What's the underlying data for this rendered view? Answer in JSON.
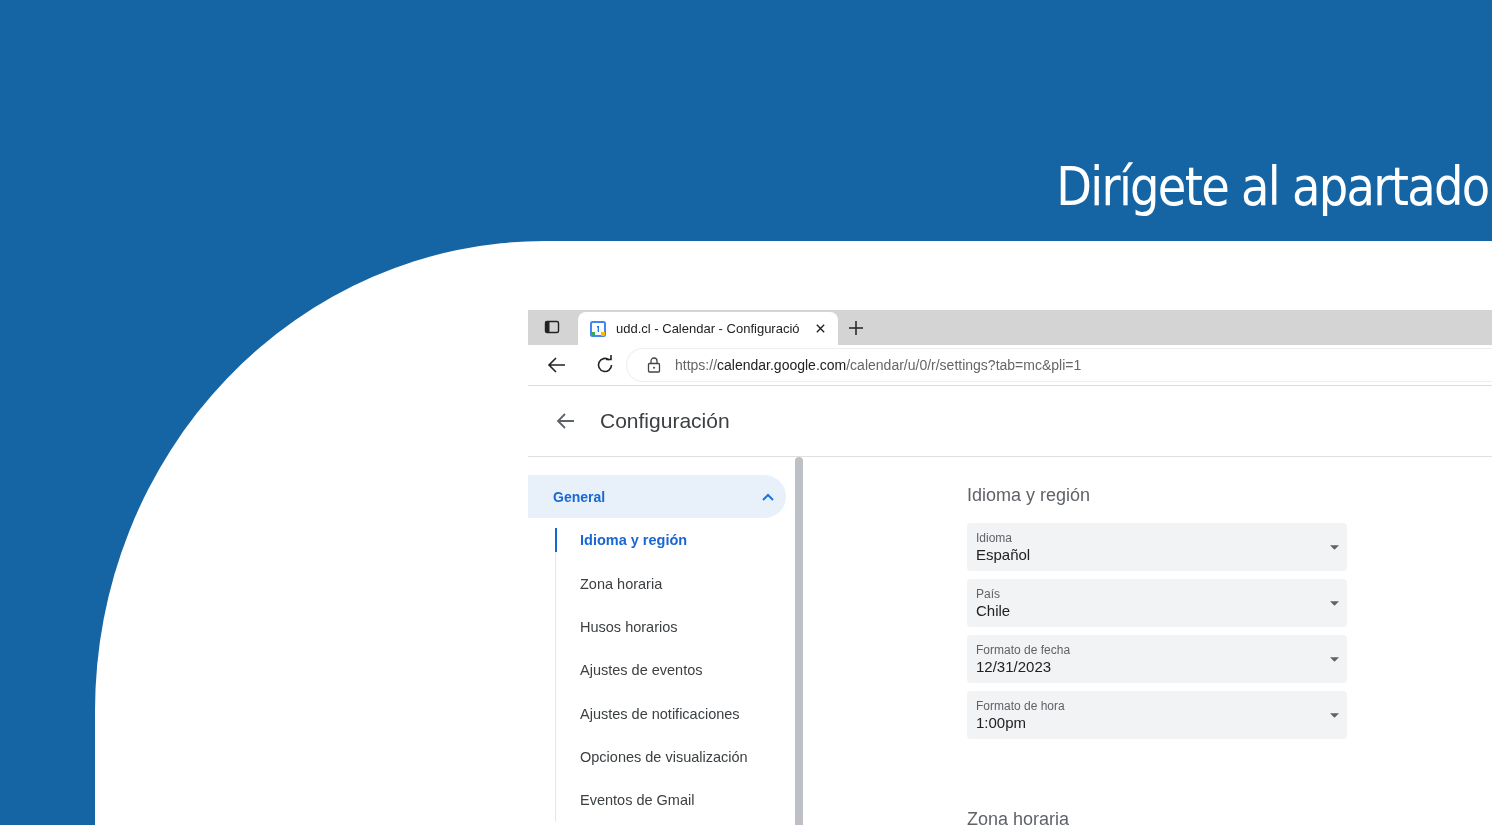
{
  "slide": {
    "title": "Dirígete al apartado"
  },
  "browser": {
    "tab": {
      "title": "udd.cl - Calendar - Configuració",
      "selected": true
    },
    "url": {
      "scheme": "https://",
      "host": "calendar.google.com",
      "path": "/calendar/u/0/r/settings?tab=mc&pli=1"
    }
  },
  "app": {
    "title": "Configuración"
  },
  "sidebar": {
    "group": {
      "label": "General",
      "expanded": true,
      "children": [
        {
          "label": "Idioma y región",
          "selected": true
        },
        {
          "label": "Zona horaria",
          "selected": false
        },
        {
          "label": "Husos horarios",
          "selected": false
        },
        {
          "label": "Ajustes de eventos",
          "selected": false
        },
        {
          "label": "Ajustes de notificaciones",
          "selected": false
        },
        {
          "label": "Opciones de visualización",
          "selected": false
        },
        {
          "label": "Eventos de Gmail",
          "selected": false
        }
      ]
    }
  },
  "section": {
    "title": "Idioma y región",
    "fields": [
      {
        "label": "Idioma",
        "value": "Español"
      },
      {
        "label": "País",
        "value": "Chile"
      },
      {
        "label": "Formato de fecha",
        "value": "12/31/2023"
      },
      {
        "label": "Formato de hora",
        "value": "1:00pm"
      }
    ]
  },
  "next_section": {
    "title": "Zona horaria"
  }
}
